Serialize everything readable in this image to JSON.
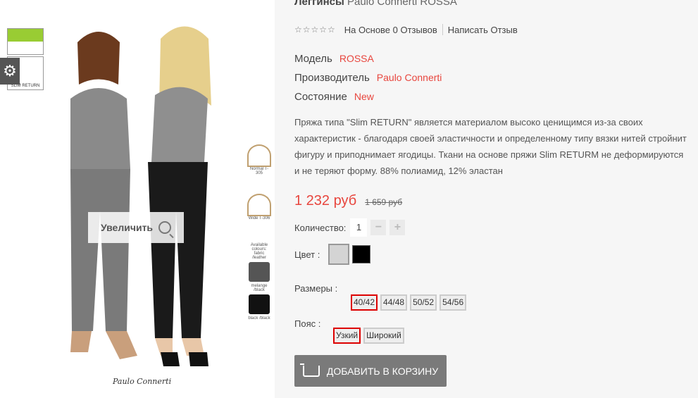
{
  "product": {
    "title_bold": "Леггинсы",
    "title_rest": "Paulo Connerti ROSSA",
    "stars": "☆☆☆☆☆",
    "reviews_link": "На Основе 0 Отзывов",
    "write_review": "Написать Отзыв",
    "meta": [
      {
        "label": "Модель",
        "value": "ROSSA"
      },
      {
        "label": "Производитель",
        "value": "Paulo Connerti"
      },
      {
        "label": "Состояние",
        "value": "New"
      }
    ],
    "description": "Пряжа типа \"Slim RETURN\" является материалом высоко ценищимся из-за своих характеристик - благодаря своей эластичности и определенному типу вязки нитей стройнит фигуру и приподнимает ягодицы. Ткани на основе пряжи Slim RETURM не деформируются и не теряют форму. 88% полиамид, 12% эластан",
    "price_new": "1 232 руб",
    "price_old": "1 659 руб",
    "qty_label": "Количество:",
    "qty_value": "1",
    "qty_minus": "−",
    "qty_plus": "+",
    "color_label": "Цвет :",
    "colors": [
      "#d4d4d4",
      "#000000"
    ],
    "sizes_label": "Размеры :",
    "sizes": [
      "40/42",
      "44/48",
      "50/52",
      "54/56"
    ],
    "belt_label": "Пояс :",
    "belts": [
      "Узкий",
      "Широкий"
    ],
    "cart_button": "ДОБАВИТЬ В КОРЗИНУ"
  },
  "gallery": {
    "zoom_label": "Увеличить",
    "signature": "Paulo Connerti",
    "badge_text": "SLIM RETURN",
    "thumbs": [
      {
        "label": "Normal T-305"
      },
      {
        "label": "Wide T-306"
      },
      {
        "label": "Available colours: fabric /leather"
      },
      {
        "label": "melange /black"
      },
      {
        "label": "black /black"
      }
    ],
    "gear_icon": "⚙"
  }
}
